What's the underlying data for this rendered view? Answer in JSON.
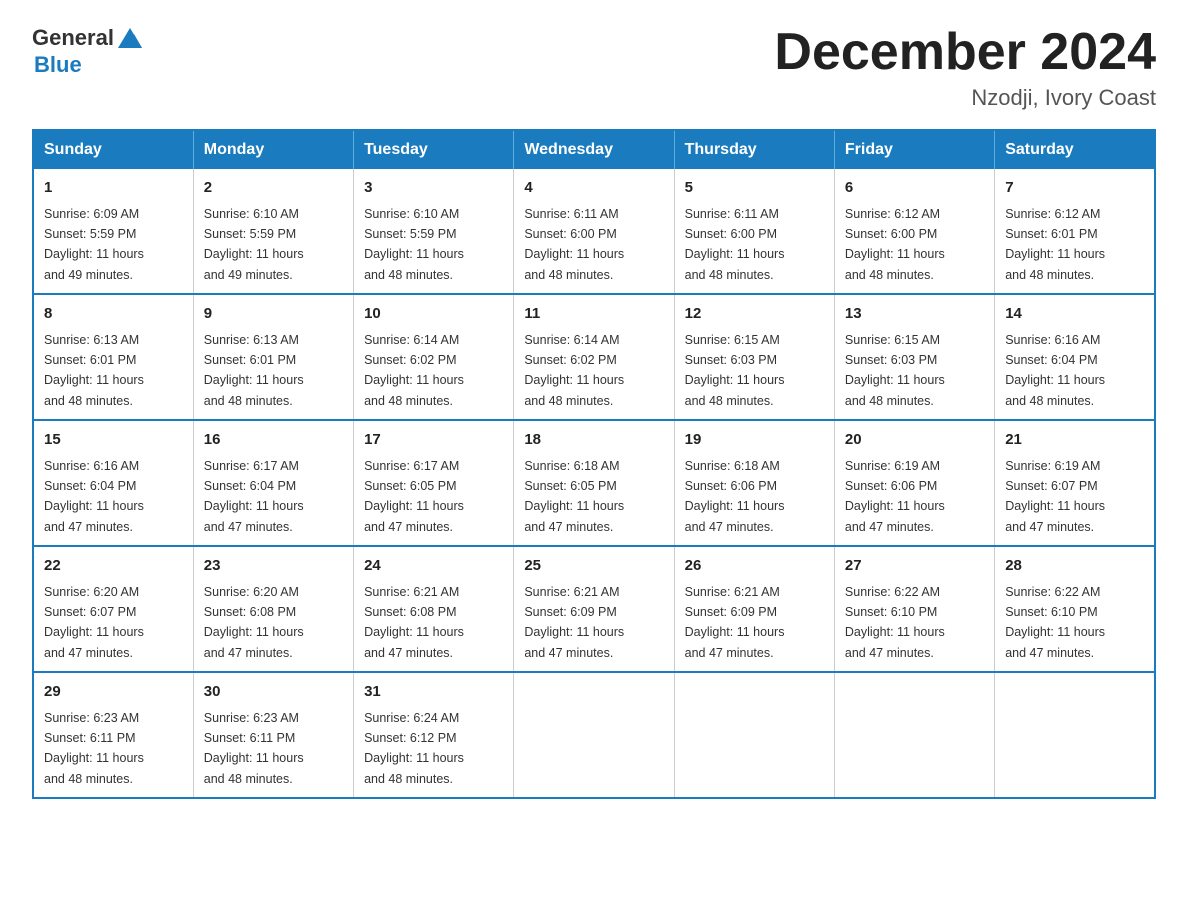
{
  "header": {
    "logo_general": "General",
    "logo_blue": "Blue",
    "month_title": "December 2024",
    "location": "Nzodji, Ivory Coast"
  },
  "days_of_week": [
    "Sunday",
    "Monday",
    "Tuesday",
    "Wednesday",
    "Thursday",
    "Friday",
    "Saturday"
  ],
  "weeks": [
    [
      {
        "day": "1",
        "sunrise": "6:09 AM",
        "sunset": "5:59 PM",
        "daylight": "11 hours and 49 minutes."
      },
      {
        "day": "2",
        "sunrise": "6:10 AM",
        "sunset": "5:59 PM",
        "daylight": "11 hours and 49 minutes."
      },
      {
        "day": "3",
        "sunrise": "6:10 AM",
        "sunset": "5:59 PM",
        "daylight": "11 hours and 48 minutes."
      },
      {
        "day": "4",
        "sunrise": "6:11 AM",
        "sunset": "6:00 PM",
        "daylight": "11 hours and 48 minutes."
      },
      {
        "day": "5",
        "sunrise": "6:11 AM",
        "sunset": "6:00 PM",
        "daylight": "11 hours and 48 minutes."
      },
      {
        "day": "6",
        "sunrise": "6:12 AM",
        "sunset": "6:00 PM",
        "daylight": "11 hours and 48 minutes."
      },
      {
        "day": "7",
        "sunrise": "6:12 AM",
        "sunset": "6:01 PM",
        "daylight": "11 hours and 48 minutes."
      }
    ],
    [
      {
        "day": "8",
        "sunrise": "6:13 AM",
        "sunset": "6:01 PM",
        "daylight": "11 hours and 48 minutes."
      },
      {
        "day": "9",
        "sunrise": "6:13 AM",
        "sunset": "6:01 PM",
        "daylight": "11 hours and 48 minutes."
      },
      {
        "day": "10",
        "sunrise": "6:14 AM",
        "sunset": "6:02 PM",
        "daylight": "11 hours and 48 minutes."
      },
      {
        "day": "11",
        "sunrise": "6:14 AM",
        "sunset": "6:02 PM",
        "daylight": "11 hours and 48 minutes."
      },
      {
        "day": "12",
        "sunrise": "6:15 AM",
        "sunset": "6:03 PM",
        "daylight": "11 hours and 48 minutes."
      },
      {
        "day": "13",
        "sunrise": "6:15 AM",
        "sunset": "6:03 PM",
        "daylight": "11 hours and 48 minutes."
      },
      {
        "day": "14",
        "sunrise": "6:16 AM",
        "sunset": "6:04 PM",
        "daylight": "11 hours and 48 minutes."
      }
    ],
    [
      {
        "day": "15",
        "sunrise": "6:16 AM",
        "sunset": "6:04 PM",
        "daylight": "11 hours and 47 minutes."
      },
      {
        "day": "16",
        "sunrise": "6:17 AM",
        "sunset": "6:04 PM",
        "daylight": "11 hours and 47 minutes."
      },
      {
        "day": "17",
        "sunrise": "6:17 AM",
        "sunset": "6:05 PM",
        "daylight": "11 hours and 47 minutes."
      },
      {
        "day": "18",
        "sunrise": "6:18 AM",
        "sunset": "6:05 PM",
        "daylight": "11 hours and 47 minutes."
      },
      {
        "day": "19",
        "sunrise": "6:18 AM",
        "sunset": "6:06 PM",
        "daylight": "11 hours and 47 minutes."
      },
      {
        "day": "20",
        "sunrise": "6:19 AM",
        "sunset": "6:06 PM",
        "daylight": "11 hours and 47 minutes."
      },
      {
        "day": "21",
        "sunrise": "6:19 AM",
        "sunset": "6:07 PM",
        "daylight": "11 hours and 47 minutes."
      }
    ],
    [
      {
        "day": "22",
        "sunrise": "6:20 AM",
        "sunset": "6:07 PM",
        "daylight": "11 hours and 47 minutes."
      },
      {
        "day": "23",
        "sunrise": "6:20 AM",
        "sunset": "6:08 PM",
        "daylight": "11 hours and 47 minutes."
      },
      {
        "day": "24",
        "sunrise": "6:21 AM",
        "sunset": "6:08 PM",
        "daylight": "11 hours and 47 minutes."
      },
      {
        "day": "25",
        "sunrise": "6:21 AM",
        "sunset": "6:09 PM",
        "daylight": "11 hours and 47 minutes."
      },
      {
        "day": "26",
        "sunrise": "6:21 AM",
        "sunset": "6:09 PM",
        "daylight": "11 hours and 47 minutes."
      },
      {
        "day": "27",
        "sunrise": "6:22 AM",
        "sunset": "6:10 PM",
        "daylight": "11 hours and 47 minutes."
      },
      {
        "day": "28",
        "sunrise": "6:22 AM",
        "sunset": "6:10 PM",
        "daylight": "11 hours and 47 minutes."
      }
    ],
    [
      {
        "day": "29",
        "sunrise": "6:23 AM",
        "sunset": "6:11 PM",
        "daylight": "11 hours and 48 minutes."
      },
      {
        "day": "30",
        "sunrise": "6:23 AM",
        "sunset": "6:11 PM",
        "daylight": "11 hours and 48 minutes."
      },
      {
        "day": "31",
        "sunrise": "6:24 AM",
        "sunset": "6:12 PM",
        "daylight": "11 hours and 48 minutes."
      },
      null,
      null,
      null,
      null
    ]
  ],
  "labels": {
    "sunrise": "Sunrise:",
    "sunset": "Sunset:",
    "daylight": "Daylight:"
  }
}
